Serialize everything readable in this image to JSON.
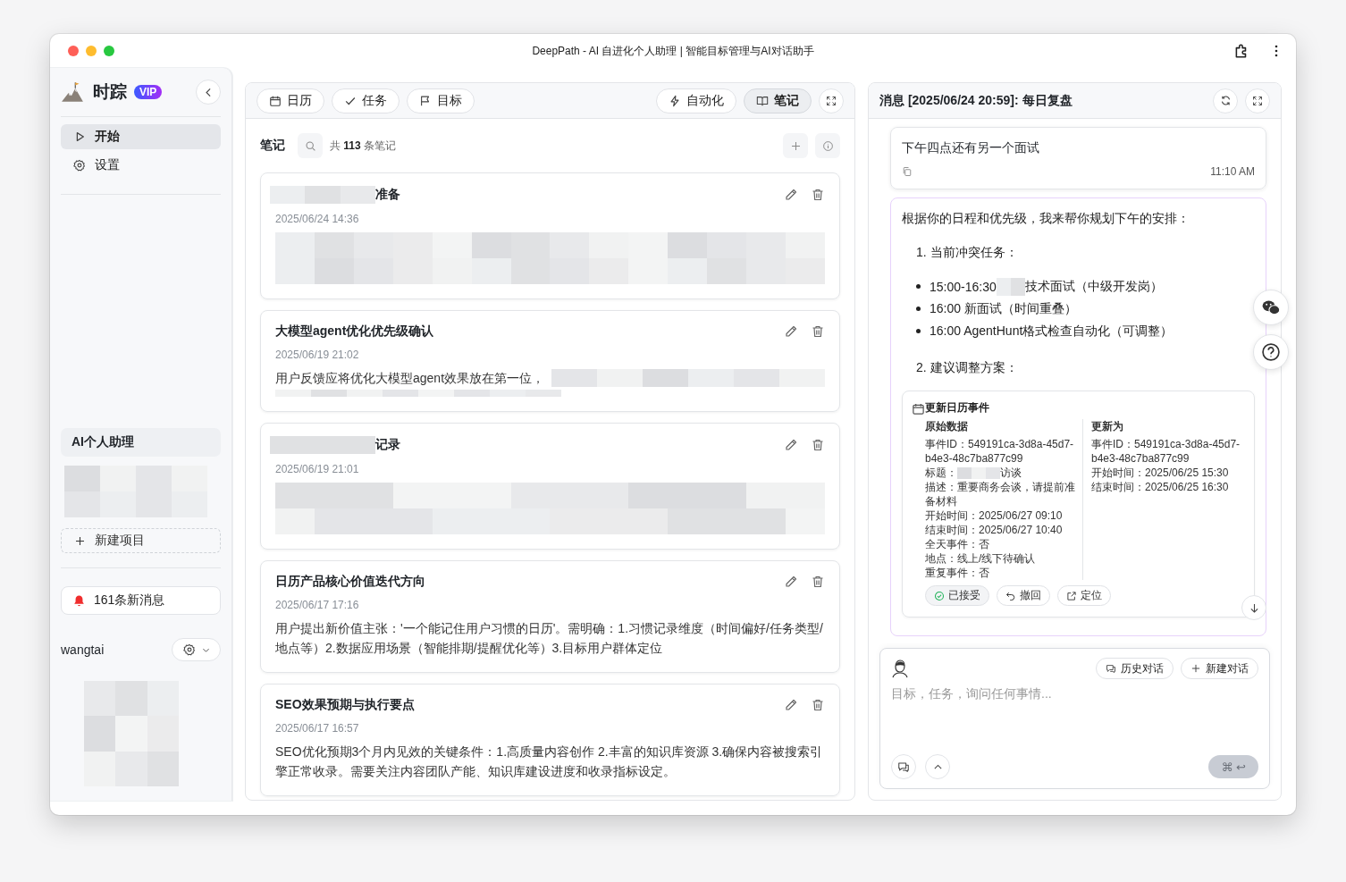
{
  "window": {
    "title": "DeepPath - AI 自进化个人助理 | 智能目标管理与AI对话助手"
  },
  "sidebar": {
    "app_name": "时踪",
    "badge": "VIP",
    "nav": [
      {
        "label": "开始",
        "selected": true
      },
      {
        "label": "设置",
        "selected": false
      }
    ],
    "project_group": {
      "label": "AI个人助理",
      "redacted": true
    },
    "new_project": "新建项目",
    "notifications": "161条新消息",
    "user": {
      "name": "wangtai",
      "redacted_image": true
    }
  },
  "toolbar": {
    "left_tabs": [
      {
        "label": "日历",
        "selected": false
      },
      {
        "label": "任务",
        "selected": false
      },
      {
        "label": "目标",
        "selected": false
      }
    ],
    "right_tabs": [
      {
        "label": "自动化",
        "selected": false
      },
      {
        "label": "笔记",
        "selected": true
      }
    ]
  },
  "notes": {
    "heading": "笔记",
    "count": "共 **113** 条笔记",
    "items": [
      {
        "title": "准备",
        "title_redacted": true,
        "date": "2025/06/24 14:36",
        "body_redacted": true
      },
      {
        "title": "大模型agent优化优先级确认",
        "title_redacted": false,
        "date": "2025/06/19 21:02",
        "body": "用户反馈应将优化大模型agent效果放在第一位，",
        "body_redacted": true
      },
      {
        "title": "记录",
        "title_redacted": true,
        "date": "2025/06/19 21:01",
        "body_redacted": true
      },
      {
        "title": "日历产品核心价值迭代方向",
        "title_redacted": false,
        "date": "2025/06/17 17:16",
        "body": "用户提出新价值主张：'一个能记住用户习惯的日历'。需明确：1.习惯记录维度（时间偏好/任务类型/地点等）2.数据应用场景（智能排期/提醒优化等）3.目标用户群体定位",
        "body_redacted": false
      },
      {
        "title": "SEO效果预期与执行要点",
        "title_redacted": false,
        "date": "2025/06/17 16:57",
        "body": "SEO优化预期3个月内见效的关键条件：1.高质量内容创作 2.丰富的知识库资源 3.确保内容被搜索引擎正常收录。需要关注内容团队产能、知识库建设进度和收录指标设定。",
        "body_redacted": false
      }
    ]
  },
  "chat": {
    "title": "消息 [2025/06/24 20:59]: 每日复盘",
    "user_message": {
      "text": "下午四点还有另一个面试",
      "time": "11:10 AM"
    },
    "reply": {
      "intro": "根据你的日程和优先级，我来帮你规划下午的安排：",
      "sections": [
        {
          "heading": "1. 当前冲突任务：",
          "bullets": [
            {
              "lead": "15:00-16:30",
              "redacted": true,
              "text": "技术面试（中级开发岗）"
            },
            {
              "text": "16:00 新面试（时间重叠）",
              "redacted": false
            },
            {
              "text": "16:00 AgentHunt格式检查自动化（可调整）",
              "redacted": false
            }
          ]
        },
        {
          "heading": "2. 建议调整方案："
        }
      ],
      "event_card": {
        "title": "更新日历事件",
        "columns": [
          {
            "heading": "原始数据",
            "lines": [
              {
                "label": "事件ID：",
                "value": "549191ca-3d8a-45d7-b4e3-48c7ba877c99",
                "redacted": false
              },
              {
                "label": "标题：",
                "value": "访谈",
                "redacted": true
              },
              {
                "label": "描述：",
                "value": "重要商务会谈，请提前准备材料",
                "redacted": false
              },
              {
                "label": "开始时间：",
                "value": "2025/06/27 09:10",
                "redacted": false
              },
              {
                "label": "结束时间：",
                "value": "2025/06/27 10:40",
                "redacted": false
              },
              {
                "label": "全天事件：",
                "value": "否",
                "redacted": false
              },
              {
                "label": "地点：",
                "value": "线上/线下待确认",
                "redacted": false
              },
              {
                "label": "重复事件：",
                "value": "否",
                "redacted": false
              }
            ]
          },
          {
            "heading": "更新为",
            "lines": [
              {
                "label": "事件ID：",
                "value": "549191ca-3d8a-45d7-b4e3-48c7ba877c99",
                "redacted": false
              },
              {
                "label": "开始时间：",
                "value": "2025/06/25 15:30",
                "redacted": false
              },
              {
                "label": "结束时间：",
                "value": "2025/06/25 16:30",
                "redacted": false
              }
            ]
          }
        ],
        "actions": [
          {
            "label": "已接受",
            "kind": "accepted"
          },
          {
            "label": "撤回",
            "kind": "undo"
          },
          {
            "label": "定位",
            "kind": "locate"
          }
        ]
      }
    },
    "composer": {
      "placeholder": "目标，任务，询问任何事情...",
      "buttons": [
        {
          "label": "历史对话",
          "kind": "history"
        },
        {
          "label": "新建对话",
          "kind": "new"
        }
      ],
      "send_keys": "⌘ ↩"
    }
  }
}
